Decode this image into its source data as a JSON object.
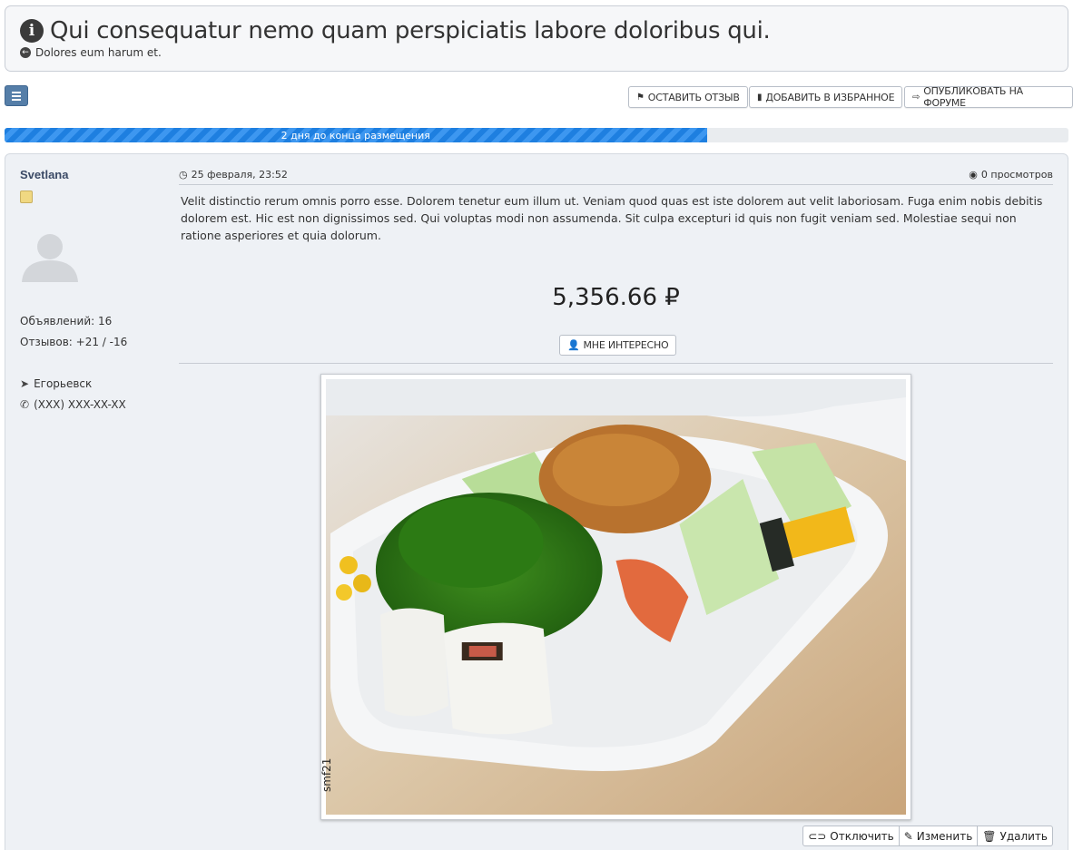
{
  "header": {
    "title": "Qui consequatur nemo quam perspiciatis labore doloribus qui.",
    "back_link": "Dolores eum harum et."
  },
  "toolbar": {
    "review_label": "Оставить отзыв",
    "favorite_label": "Добавить в избранное",
    "forum_label": "Опубликовать на форуме"
  },
  "progress": {
    "label": "2 дня до конца размещения",
    "fraction": 0.66,
    "fill_color": "#1e7fe0"
  },
  "author": {
    "name": "Svetlana",
    "ads": "Объявлений: 16",
    "reviews": "Отзывов: +21 / -16",
    "city": "Егорьевск",
    "phone": "(XXX) XXX-XX-XX"
  },
  "post": {
    "date": "25 февраля, 23:52",
    "views": "0 просмотров",
    "body": "Velit distinctio rerum omnis porro esse. Dolorem tenetur eum illum ut. Veniam quod quas est iste dolorem aut velit laboriosam. Fuga enim nobis debitis dolorem est. Hic est non dignissimos sed. Qui voluptas modi non assumenda. Sit culpa excepturi id quis non fugit veniam sed. Molestiae sequi non ratione asperiores et quia dolorum.",
    "price": "5,356.66 ₽",
    "interest_label": "Мне интересно",
    "watermark": "smf21"
  },
  "actions": {
    "disable": "Отключить",
    "edit": "Изменить",
    "delete": "Удалить"
  },
  "icons": {
    "info": "info-circle-icon",
    "back": "arrow-circle-left-icon",
    "menu": "hamburger-icon",
    "flag": "flag-icon",
    "bookmark": "bookmark-icon",
    "share": "share-icon",
    "clock": "clock-icon",
    "eye": "eye-icon",
    "location": "location-arrow-icon",
    "phone": "phone-icon",
    "user_plus": "user-plus-icon",
    "toggle": "toggle-icon",
    "edit": "edit-icon",
    "trash": "trash-icon"
  }
}
